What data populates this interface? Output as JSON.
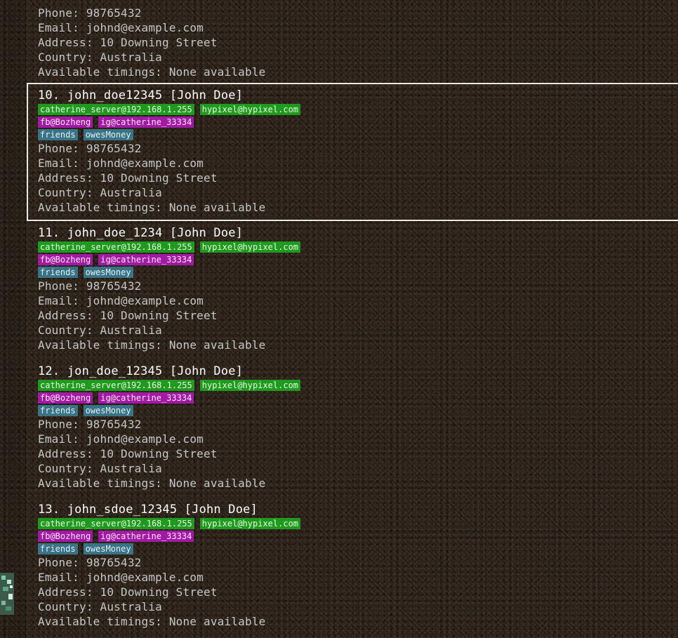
{
  "entries": [
    {
      "title": "",
      "servers": [],
      "socials": [],
      "groups": [
        "",
        ""
      ],
      "phone": "Phone: 98765432",
      "email": "Email: johnd@example.com",
      "address": "Address: 10 Downing Street",
      "country": "Country: Australia",
      "timings": "Available timings: None available"
    },
    {
      "title": "10. john_doe12345 [John Doe]",
      "servers": [
        "catherine_server@192.168.1.255",
        "hypixel@hypixel.com"
      ],
      "socials": [
        "fb@Bozheng",
        "ig@catherine_33334"
      ],
      "groups": [
        "friends",
        "owesMoney"
      ],
      "phone": "Phone: 98765432",
      "email": "Email: johnd@example.com",
      "address": "Address: 10 Downing Street",
      "country": "Country: Australia",
      "timings": "Available timings: None available",
      "selected": true
    },
    {
      "title": "11. john_doe_1234 [John Doe]",
      "servers": [
        "catherine_server@192.168.1.255",
        "hypixel@hypixel.com"
      ],
      "socials": [
        "fb@Bozheng",
        "ig@catherine_33334"
      ],
      "groups": [
        "friends",
        "owesMoney"
      ],
      "phone": "Phone: 98765432",
      "email": "Email: johnd@example.com",
      "address": "Address: 10 Downing Street",
      "country": "Country: Australia",
      "timings": "Available timings: None available"
    },
    {
      "title": "12. jon_doe_12345 [John Doe]",
      "servers": [
        "catherine_server@192.168.1.255",
        "hypixel@hypixel.com"
      ],
      "socials": [
        "fb@Bozheng",
        "ig@catherine_33334"
      ],
      "groups": [
        "friends",
        "owesMoney"
      ],
      "phone": "Phone: 98765432",
      "email": "Email: johnd@example.com",
      "address": "Address: 10 Downing Street",
      "country": "Country: Australia",
      "timings": "Available timings: None available"
    },
    {
      "title": "13. john_sdoe_12345 [John Doe]",
      "servers": [
        "catherine_server@192.168.1.255",
        "hypixel@hypixel.com"
      ],
      "socials": [
        "fb@Bozheng",
        "ig@catherine_33334"
      ],
      "groups": [
        "friends",
        "owesMoney"
      ],
      "phone": "Phone: 98765432",
      "email": "Email: johnd@example.com",
      "address": "Address: 10 Downing Street",
      "country": "Country: Australia",
      "timings": "Available timings: None available"
    }
  ],
  "icons": {
    "side_block": "minecraft-block-icon"
  },
  "colors": {
    "server_tag": "#1f9a1f",
    "social_tag": "#a21aa4",
    "group_tag": "#3a7286",
    "selection_border": "#e8e8e8"
  }
}
